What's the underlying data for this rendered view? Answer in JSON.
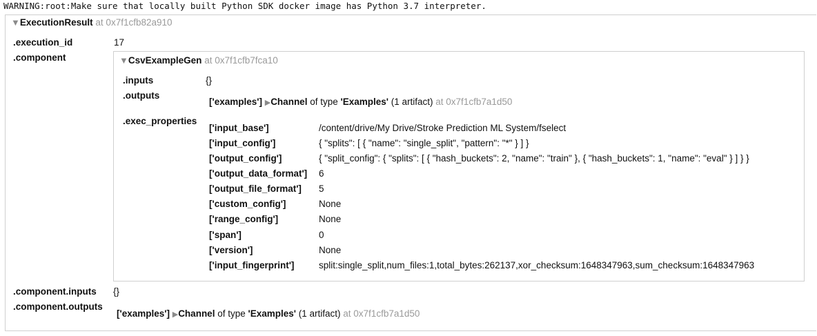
{
  "warning": "WARNING:root:Make sure that locally built Python SDK docker image has Python 3.7 interpreter.",
  "result": {
    "class_name": "ExecutionResult",
    "address": "at 0x7f1cfb82a910",
    "execution_id_key": ".execution_id",
    "execution_id_value": "17",
    "component_key": ".component",
    "component_inputs_key": ".component.inputs",
    "component_inputs_value": "{}",
    "component_outputs_key": ".component.outputs"
  },
  "component": {
    "class_name": "CsvExampleGen",
    "address": "at 0x7f1cfb7fca10",
    "inputs_key": ".inputs",
    "inputs_value": "{}",
    "outputs_key": ".outputs",
    "exec_properties_key": ".exec_properties"
  },
  "channel": {
    "key": "['examples']",
    "name": "Channel",
    "of_type": "of type",
    "type": "'Examples'",
    "count": "(1 artifact)",
    "address": "at 0x7f1cfb7a1d50"
  },
  "exec_properties": [
    {
      "key": "['input_base']",
      "value": "/content/drive/My Drive/Stroke Prediction ML System/fselect"
    },
    {
      "key": "['input_config']",
      "value": "{ \"splits\": [ { \"name\": \"single_split\", \"pattern\": \"*\" } ] }"
    },
    {
      "key": "['output_config']",
      "value": "{ \"split_config\": { \"splits\": [ { \"hash_buckets\": 2, \"name\": \"train\" }, { \"hash_buckets\": 1, \"name\": \"eval\" } ] } }"
    },
    {
      "key": "['output_data_format']",
      "value": "6"
    },
    {
      "key": "['output_file_format']",
      "value": "5"
    },
    {
      "key": "['custom_config']",
      "value": "None"
    },
    {
      "key": "['range_config']",
      "value": "None"
    },
    {
      "key": "['span']",
      "value": "0"
    },
    {
      "key": "['version']",
      "value": "None"
    },
    {
      "key": "['input_fingerprint']",
      "value": "split:single_split,num_files:1,total_bytes:262137,xor_checksum:1648347963,sum_checksum:1648347963"
    }
  ]
}
